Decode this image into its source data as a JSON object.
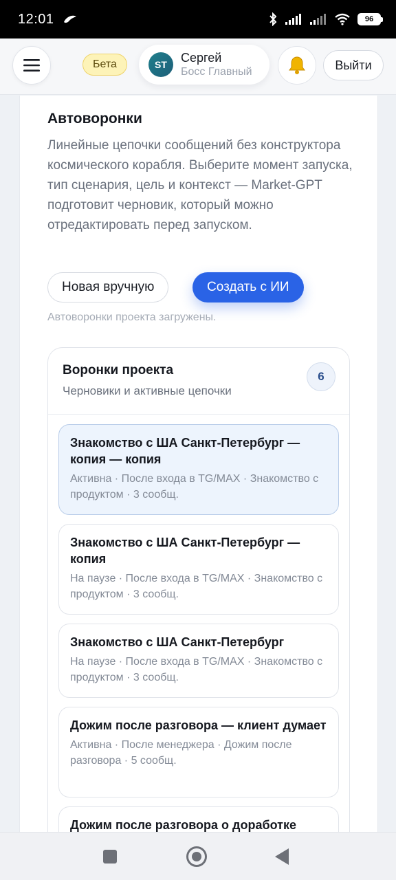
{
  "status_bar": {
    "time": "12:01",
    "battery": "96"
  },
  "header": {
    "beta_label": "Бета",
    "user": {
      "initials": "ST",
      "name": "Сергей",
      "role": "Босс Главный"
    },
    "logout_label": "Выйти",
    "icons": [
      "menu-icon",
      "bell-icon"
    ]
  },
  "main": {
    "title": "Автоворонки",
    "description": "Линейные цепочки сообщений без конструктора космического корабля. Выберите момент запуска, тип сценария, цель и контекст — Market-GPT подготовит черновик, который можно отредактировать перед запуском.",
    "buttons": {
      "manual": "Новая вручную",
      "ai": "Создать с ИИ"
    },
    "status": "Автоворонки проекта загружены.",
    "accent_color": "#2a63e6"
  },
  "funnels": {
    "title": "Воронки проекта",
    "subtitle": "Черновики и активные цепочки",
    "count": "6",
    "items": [
      {
        "name": "Знакомство с ША Санкт-Петербург — копия — копия",
        "meta": "Активна · После входа в TG/MAX · Знакомство с продуктом · 3 сообщ.",
        "selected": true
      },
      {
        "name": "Знакомство с ША Санкт-Петербург — копия",
        "meta": "На паузе · После входа в TG/MAX · Знакомство с продуктом · 3 сообщ.",
        "selected": false
      },
      {
        "name": "Знакомство с ША Санкт-Петербург",
        "meta": "На паузе · После входа в TG/MAX · Знакомство с продуктом · 3 сообщ.",
        "selected": false
      },
      {
        "name": "Дожим после разговора — клиент думает",
        "meta": "Активна · После менеджера · Дожим после разговора · 5 сообщ.",
        "selected": false
      },
      {
        "name": "Дожим после разговора о доработке",
        "meta": "",
        "selected": false
      }
    ]
  }
}
